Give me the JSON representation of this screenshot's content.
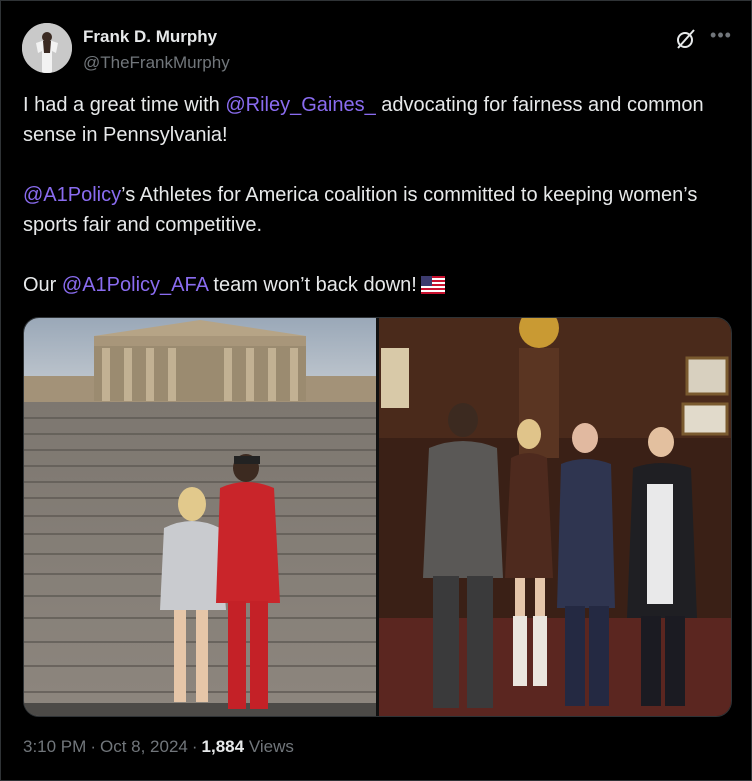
{
  "author": {
    "name": "Frank D. Murphy",
    "handle": "@TheFrankMurphy"
  },
  "icons": {
    "grok": "grok-icon",
    "more": "more-icon",
    "flag": "us-flag-emoji"
  },
  "tweet": {
    "line1_pre": "I had a great time with ",
    "mention1": "@Riley_Gaines_",
    "line1_post": " advocating for fairness and common sense in Pennsylvania!",
    "mention2": "@A1Policy",
    "line2_post": "’s Athletes for America coalition is committed to keeping women’s sports fair and competitive.",
    "line3_pre": "Our ",
    "mention3": "@A1Policy_AFA",
    "line3_post": " team won’t back down!"
  },
  "meta": {
    "time": "3:10 PM",
    "dot": "·",
    "date": "Oct 8, 2024",
    "views_count": "1,884",
    "views_label": "Views"
  },
  "colors": {
    "link": "#8a6cf0",
    "secondary": "#71767b",
    "primary": "#e7e9ea",
    "background": "#000000"
  }
}
